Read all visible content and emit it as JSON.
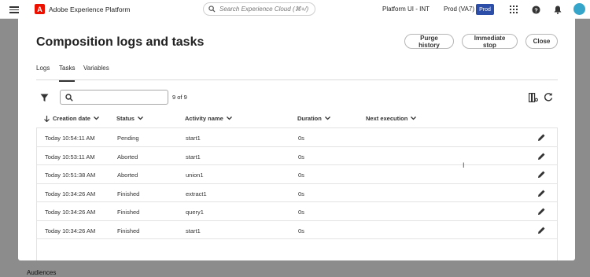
{
  "topbar": {
    "logo_letter": "A",
    "app_title": "Adobe Experience Platform",
    "search_placeholder": "Search Experience Cloud (⌘+/)",
    "sandbox": "Platform UI - INT",
    "org": "Prod (VA7)",
    "env_badge": "Prod"
  },
  "background": {
    "bottom_label": "Audiences"
  },
  "modal": {
    "title": "Composition logs and tasks",
    "buttons": {
      "purge": "Purge history",
      "stop": "Immediate stop",
      "close": "Close"
    },
    "tabs": [
      "Logs",
      "Tasks",
      "Variables"
    ],
    "active_tab": "Tasks",
    "search": {
      "value": "",
      "placeholder": ""
    },
    "count": "9 of 9",
    "columns": {
      "date": "Creation date",
      "status": "Status",
      "activity": "Activity name",
      "duration": "Duration",
      "next": "Next execution"
    },
    "rows": [
      {
        "date": "Today 10:54:11 AM",
        "status": "Pending",
        "activity": "start1",
        "duration": "0s",
        "next": ""
      },
      {
        "date": "Today 10:53:11 AM",
        "status": "Aborted",
        "activity": "start1",
        "duration": "0s",
        "next": ""
      },
      {
        "date": "Today 10:51:38 AM",
        "status": "Aborted",
        "activity": "union1",
        "duration": "0s",
        "next": ""
      },
      {
        "date": "Today 10:34:26 AM",
        "status": "Finished",
        "activity": "extract1",
        "duration": "0s",
        "next": ""
      },
      {
        "date": "Today 10:34:26 AM",
        "status": "Finished",
        "activity": "query1",
        "duration": "0s",
        "next": ""
      },
      {
        "date": "Today 10:34:26 AM",
        "status": "Finished",
        "activity": "start1",
        "duration": "0s",
        "next": ""
      }
    ]
  },
  "icons": {
    "menu": "menu-icon",
    "search": "search-icon",
    "apps": "apps-grid-icon",
    "help": "help-icon",
    "bell": "bell-icon",
    "filter": "filter-icon",
    "columns": "column-settings-icon",
    "refresh": "refresh-icon",
    "edit": "edit-pencil-icon"
  },
  "colors": {
    "brand_red": "#eb1000",
    "badge_blue": "#2d4ea8",
    "avatar": "#35a6c9",
    "overlay": "rgba(0,0,0,0.45)"
  }
}
